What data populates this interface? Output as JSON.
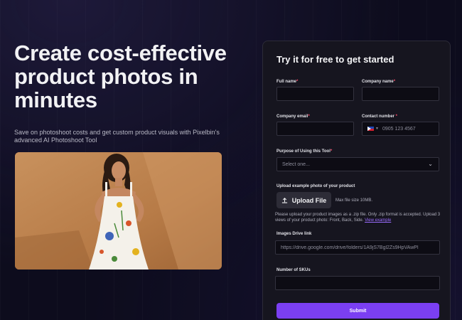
{
  "hero": {
    "title": "Create cost-effective product photos in minutes",
    "subtitle": "Save on photoshoot costs and get custom product visuals with Pixelbin's advanced AI Photoshoot Tool"
  },
  "form": {
    "title": "Try it for free to get started",
    "full_name_label": "Full name",
    "company_name_label": "Company name",
    "company_email_label": "Company email",
    "contact_number_label": "Contact number ",
    "phone_placeholder": "0905 123 4567",
    "purpose_label": "Purpose of Using this Tool",
    "purpose_selected": "Select one...",
    "upload_label": "Upload example photo of your product",
    "upload_button": "Upload File",
    "max_size": "Max file size 10MB.",
    "help_text": "Please upload your product images as a .zip file. Only .zip format is accepted. Upload 3 views of your product photo: Front, Back, Side. ",
    "view_example": "View example",
    "drive_label": "Images Drive link",
    "drive_value": "https://drive.google.com/drive/folders/1A9jS7Bgl2Zs9HpVAwPl",
    "skus_label": "Number of SKUs",
    "submit": "Submit",
    "required_mark": "*"
  },
  "icons": {
    "upload": "upload-icon",
    "chevron": "chevron-down-icon",
    "flag": "philippines-flag-icon"
  },
  "colors": {
    "background": "#0d0c1d",
    "card": "#16151f",
    "accent": "#7b3ff2",
    "required": "#ff4d6d",
    "link": "#9b6cff"
  }
}
